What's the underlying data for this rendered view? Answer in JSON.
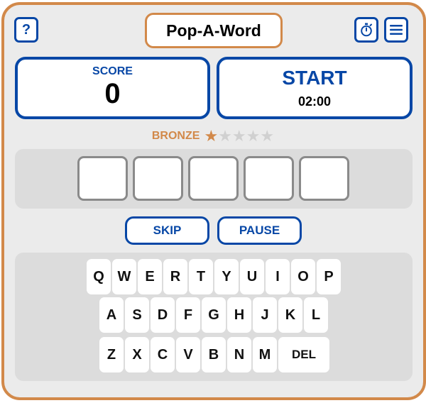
{
  "header": {
    "help_label": "?",
    "title": "Pop-A-Word",
    "timer_icon": "stopwatch-icon",
    "menu_icon": "hamburger-menu-icon"
  },
  "score": {
    "label": "SCORE",
    "value": "0"
  },
  "start": {
    "label": "START",
    "timer": "02:00"
  },
  "medal": {
    "label": "BRONZE",
    "stars_total": 5,
    "stars_filled": 1
  },
  "word": {
    "letters": [
      "",
      "",
      "",
      "",
      ""
    ]
  },
  "actions": {
    "skip": "SKIP",
    "pause": "PAUSE"
  },
  "keyboard": {
    "rows": [
      [
        "Q",
        "W",
        "E",
        "R",
        "T",
        "Y",
        "U",
        "I",
        "O",
        "P"
      ],
      [
        "A",
        "S",
        "D",
        "F",
        "G",
        "H",
        "J",
        "K",
        "L"
      ],
      [
        "Z",
        "X",
        "C",
        "V",
        "B",
        "N",
        "M",
        "DEL"
      ]
    ]
  },
  "colors": {
    "accent_blue": "#0747a6",
    "accent_orange": "#d2894a",
    "panel_bg": "#ebebeb",
    "inset_bg": "#dcdcdc",
    "star_empty": "#d0d0d0"
  }
}
